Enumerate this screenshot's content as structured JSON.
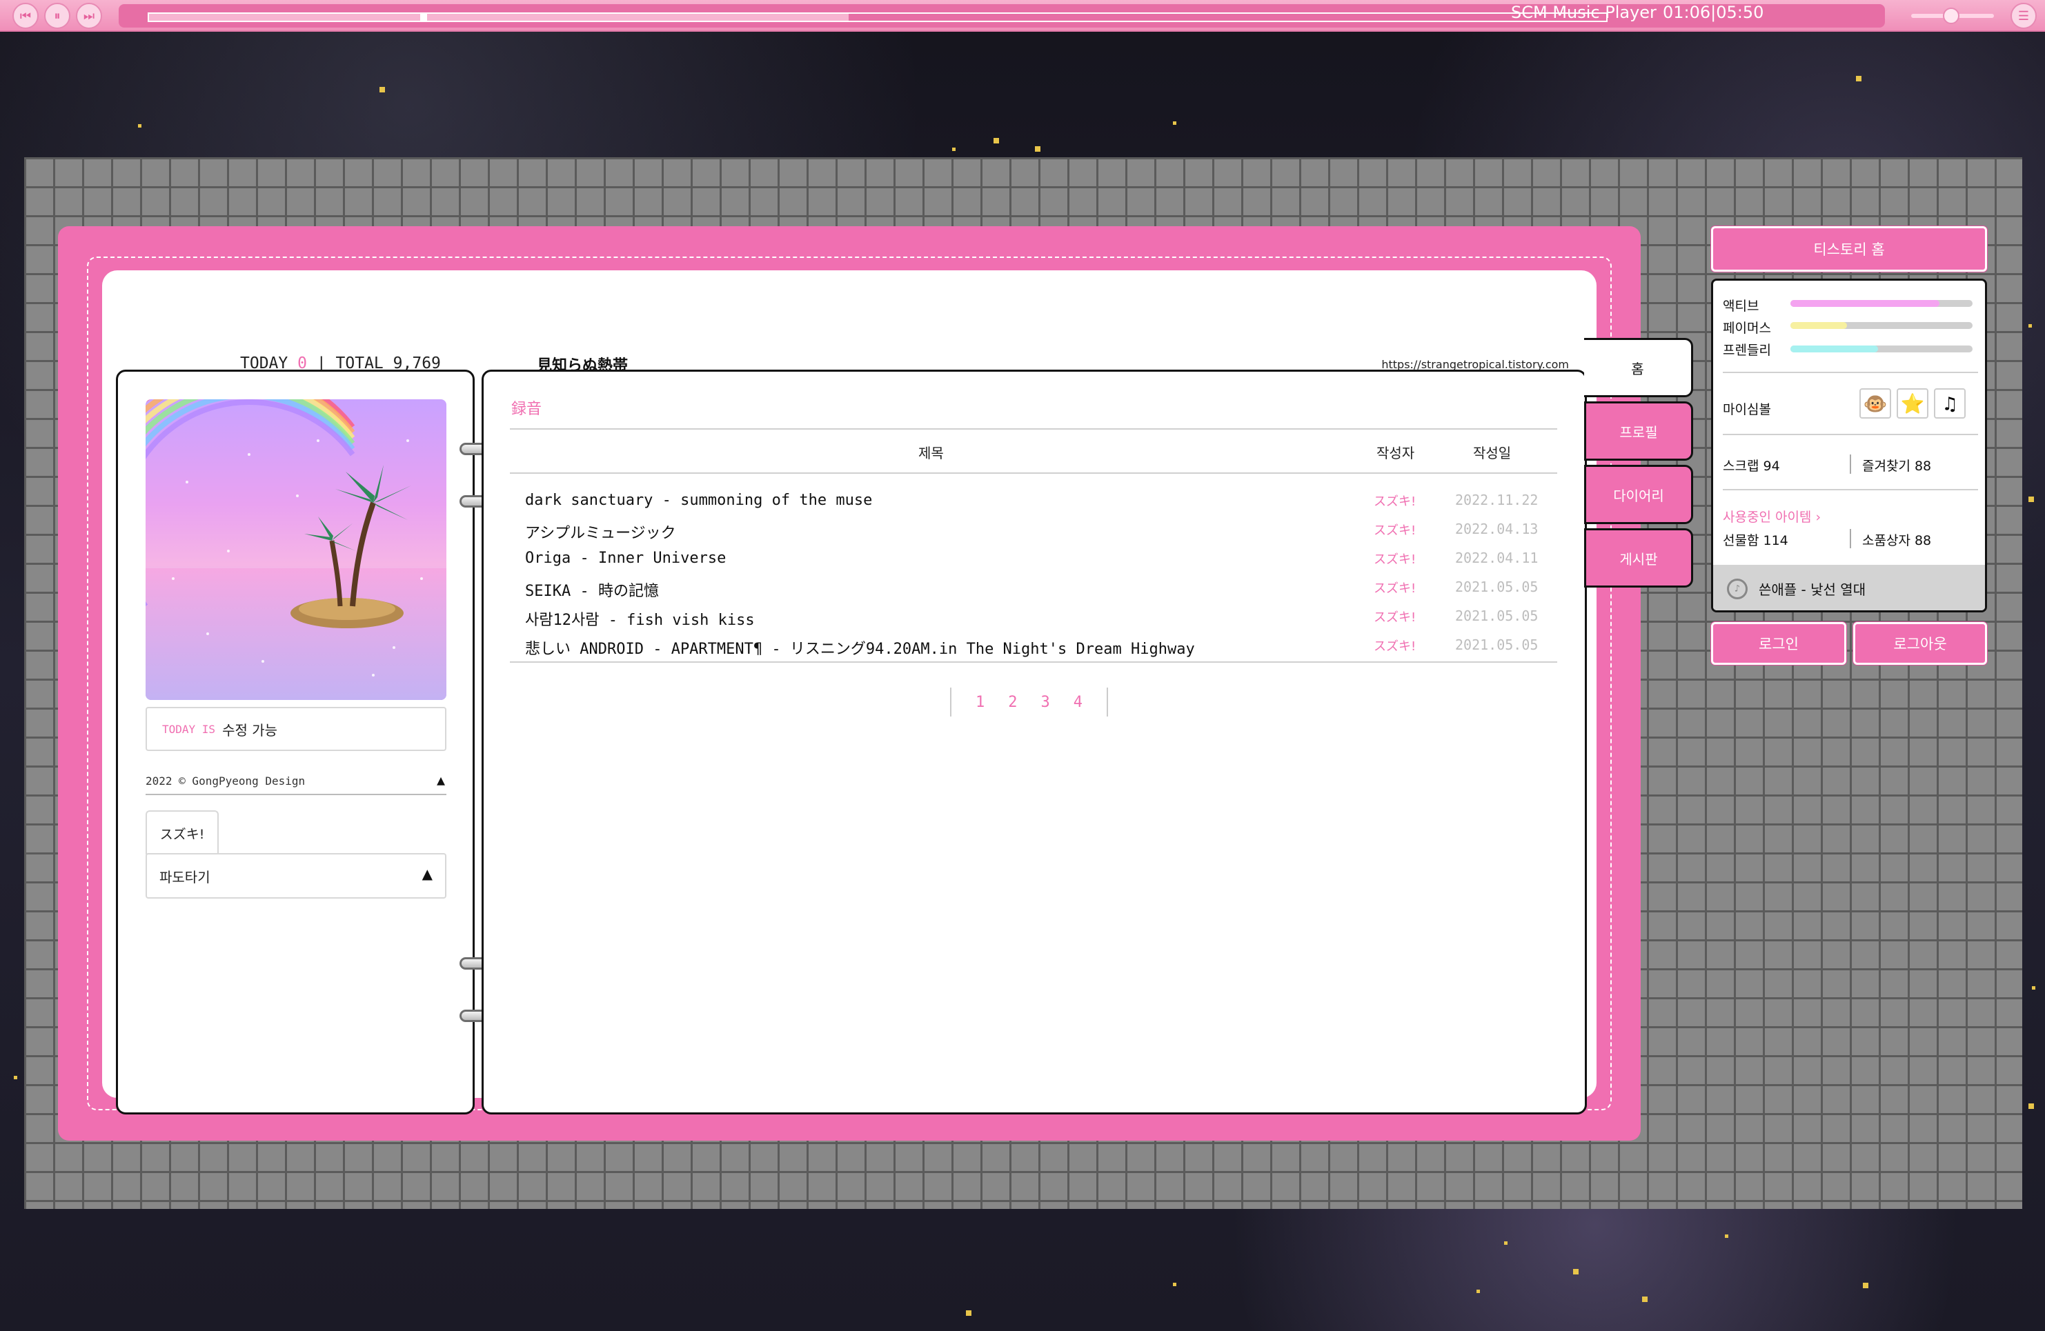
{
  "player": {
    "title": "SCM Music Player",
    "time": "01:06|05:50",
    "progress": 0.186,
    "buffered": 0.48,
    "volume": 0.48
  },
  "header": {
    "today_label": "TODAY",
    "today_count": "0",
    "separator": "|",
    "total_label": "TOTAL",
    "total_count": "9,769",
    "blog_title": "見知らぬ熱帯",
    "blog_url": "https://strangetropical.tistory.com"
  },
  "left": {
    "status_label": "TODAY IS",
    "status_value": "수정 가능",
    "copyright": "2022 © GongPyeong Design",
    "tab_label": "スズキ!",
    "select_value": "파도타기"
  },
  "board": {
    "category_title": "録音",
    "columns": {
      "title": "제목",
      "author": "작성자",
      "date": "작성일"
    },
    "posts": [
      {
        "title": "dark sanctuary - summoning of the muse",
        "author": "スズキ!",
        "date": "2022.11.22"
      },
      {
        "title": "アシプルミュージック",
        "author": "スズキ!",
        "date": "2022.04.13"
      },
      {
        "title": "Origa - Inner Universe",
        "author": "スズキ!",
        "date": "2022.04.11"
      },
      {
        "title": "SEIKA - 時の記憶",
        "author": "スズキ!",
        "date": "2021.05.05"
      },
      {
        "title": "사람12사람 - fish vish kiss",
        "author": "スズキ!",
        "date": "2021.05.05"
      },
      {
        "title": "悲しい ANDROID - APARTMENT¶ - リスニング94.20AM.in The Night's Dream Highway",
        "author": "スズキ!",
        "date": "2021.05.05"
      }
    ],
    "pages": [
      "1",
      "2",
      "3",
      "4"
    ]
  },
  "tabs": [
    "홈",
    "프로필",
    "다이어리",
    "게시판"
  ],
  "sidebar": {
    "home_button": "티스토리 홈",
    "stats": [
      {
        "label": "액티브",
        "value": 0.82,
        "color": "#f4a3f0"
      },
      {
        "label": "페이머스",
        "value": 0.31,
        "color": "#f7f0a0"
      },
      {
        "label": "프렌들리",
        "value": 0.48,
        "color": "#a6f1f0"
      }
    ],
    "symbol_label": "마이심볼",
    "symbols": [
      "monkey-icon",
      "star-icon",
      "music-note-icon"
    ],
    "scrap": "스크랩 94",
    "favorites": "즐겨찾기 88",
    "items_link": "사용중인 아이템",
    "gift_box": "선물함 114",
    "supplies_box": "소품상자 88",
    "footer": "쓴애플 - 낯선 열대",
    "login": "로그인",
    "logout": "로그아웃"
  }
}
